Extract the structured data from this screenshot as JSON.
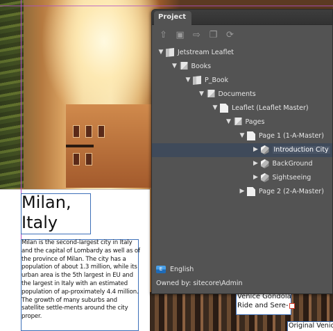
{
  "document": {
    "title": "Milan,\nItaly",
    "body": "Milan is the second-largest city in Italy and the capital of Lombardy as well as of the province of Milan. The city has a population of about 1.3 million, while its urban area is the 5th largest in EU and the largest in Italy with an estimated population of ap-proximately 4.4 million. The growth of many suburbs and satellite settle-ments around the city proper.",
    "venice_text": "Venice Gondola Ride and Sere-",
    "caption_text": "Original Venice"
  },
  "panel": {
    "tab_label": "Project",
    "toolbar": [
      {
        "name": "checkout-icon",
        "glyph": "⇧"
      },
      {
        "name": "save-icon",
        "glyph": "▣"
      },
      {
        "name": "export-icon",
        "glyph": "⇨"
      },
      {
        "name": "copy-icon",
        "glyph": "❐"
      },
      {
        "name": "refresh-icon",
        "glyph": "⟳"
      }
    ],
    "tree": [
      {
        "label": "Jetstream Leaflet",
        "icon": "book",
        "level": 0,
        "expanded": true
      },
      {
        "label": "Books",
        "icon": "docs",
        "level": 1,
        "expanded": true
      },
      {
        "label": "P_Book",
        "icon": "book",
        "level": 2,
        "expanded": true
      },
      {
        "label": "Documents",
        "icon": "docs",
        "level": 3,
        "expanded": true
      },
      {
        "label": "Leaflet (Leaflet Master)",
        "icon": "doc",
        "level": 4,
        "expanded": true
      },
      {
        "label": "Pages",
        "icon": "docs",
        "level": 5,
        "expanded": true
      },
      {
        "label": "Page 1 (1-A-Master)",
        "icon": "doc",
        "level": 6,
        "expanded": true
      },
      {
        "label": "Introduction City",
        "icon": "cube",
        "level": 7,
        "expanded": false,
        "selected": true
      },
      {
        "label": "BackGround",
        "icon": "cube",
        "level": 7,
        "expanded": false
      },
      {
        "label": "Sightseeing",
        "icon": "cube",
        "level": 7,
        "expanded": false
      },
      {
        "label": "Page 2 (2-A-Master)",
        "icon": "doc",
        "level": 6,
        "expanded": false
      }
    ],
    "language_flag": "E",
    "language": "English",
    "owned_by": "Owned by: sitecore\\Admin"
  }
}
